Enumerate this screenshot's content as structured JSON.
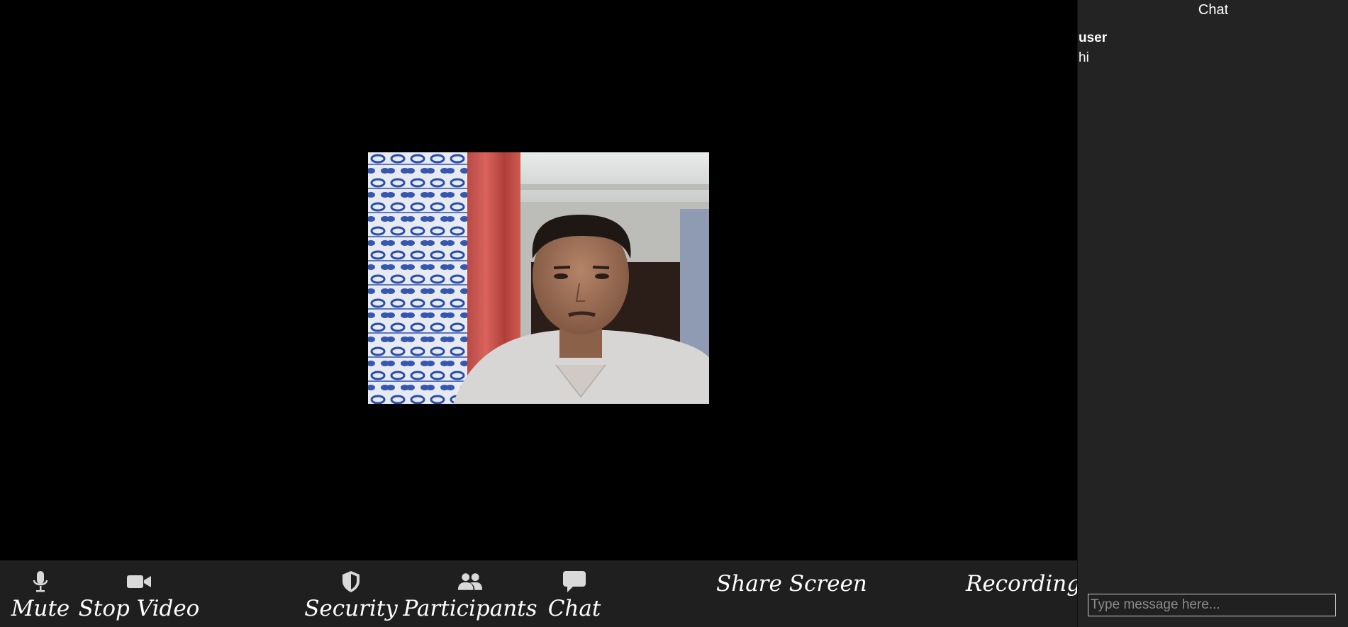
{
  "chat": {
    "title": "Chat",
    "messages": [
      {
        "user": "user",
        "text": "hi"
      }
    ],
    "input_placeholder": "Type message here..."
  },
  "toolbar": {
    "mute_label": "Mute",
    "stop_video_label": "Stop Video",
    "security_label": "Security",
    "participants_label": "Participants",
    "chat_label": "Chat",
    "share_screen_label": "Share Screen",
    "recording_label": "Recording"
  },
  "icons": {
    "mute": "microphone-icon",
    "stop_video": "video-camera-icon",
    "security": "shield-icon",
    "participants": "people-icon",
    "chat": "speech-bubble-icon"
  },
  "colors": {
    "toolbar_bg": "#1f1f1f",
    "chat_panel_bg": "#232323",
    "stage_bg": "#000000"
  }
}
